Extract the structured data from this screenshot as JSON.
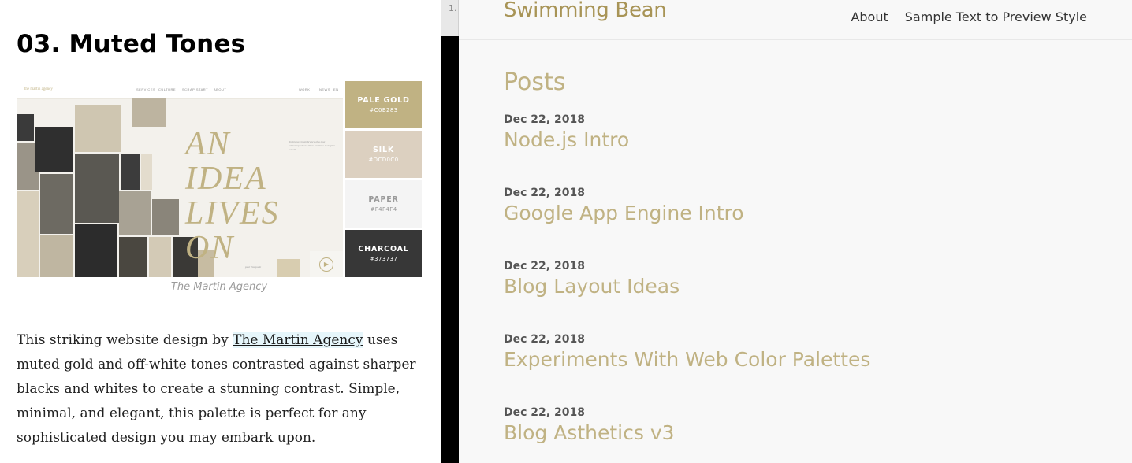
{
  "article": {
    "heading": "03. Muted Tones",
    "figure": {
      "logo_text": "the martin agency",
      "nav_items": [
        "SERVICES",
        "CULTURE",
        "SCRAP START",
        "ABOUT",
        "WORK",
        "NEWS",
        "EN"
      ],
      "headline_lines": [
        "AN",
        "IDEA",
        "LIVES",
        "ON"
      ],
      "blurb": "In loving remembrance of a true visionary whose ideas continue to inspire us all.",
      "signature": "paul Pasquale"
    },
    "swatches": [
      {
        "name": "PALE GOLD",
        "code": "#C0B283",
        "bg": "#C0B283",
        "fg": "#ffffff"
      },
      {
        "name": "SILK",
        "code": "#DCD0C0",
        "bg": "#DCD0C0",
        "fg": "#ffffff"
      },
      {
        "name": "PAPER",
        "code": "#F4F4F4",
        "bg": "#F4F4F4",
        "fg": "#9a9a9a"
      },
      {
        "name": "CHARCOAL",
        "code": "#373737",
        "bg": "#373737",
        "fg": "#ffffff"
      }
    ],
    "caption": "The Martin Agency",
    "para_before": "This striking website design by ",
    "para_link": "The Martin Agency",
    "para_after": " uses muted gold and off-white tones contrasted against sharper blacks and whites to create a stunning contrast. Simple, minimal, and elegant, this palette is perfect for any sophisticated design you may embark upon."
  },
  "divider": {
    "tab_label": "1."
  },
  "blog": {
    "site_title": "Swimming Bean",
    "nav": [
      "About",
      "Sample Text to Preview Style"
    ],
    "posts_heading": "Posts",
    "posts": [
      {
        "date": "Dec 22, 2018",
        "title": "Node.js Intro"
      },
      {
        "date": "Dec 22, 2018",
        "title": "Google App Engine Intro"
      },
      {
        "date": "Dec 22, 2018",
        "title": "Blog Layout Ideas"
      },
      {
        "date": "Dec 22, 2018",
        "title": "Experiments With Web Color Palettes"
      },
      {
        "date": "Dec 22, 2018",
        "title": "Blog Asthetics v3"
      }
    ]
  },
  "colors": {
    "gold": "#c0b283",
    "title_gold": "#a89456",
    "charcoal": "#373737"
  }
}
